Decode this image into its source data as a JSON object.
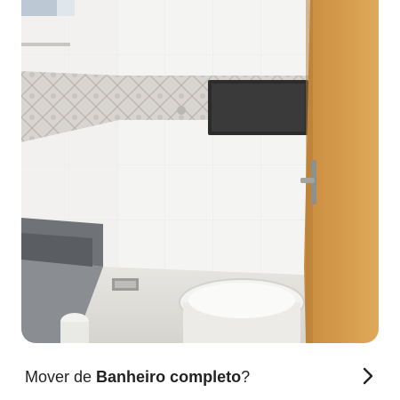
{
  "photo": {
    "alt_subject": "bathroom-photo"
  },
  "prompt": {
    "prefix": "Mover de ",
    "room_name": "Banheiro completo",
    "suffix": "?"
  },
  "icons": {
    "chevron": "chevron-right-icon"
  },
  "colors": {
    "text": "#222222",
    "background": "#ffffff"
  }
}
